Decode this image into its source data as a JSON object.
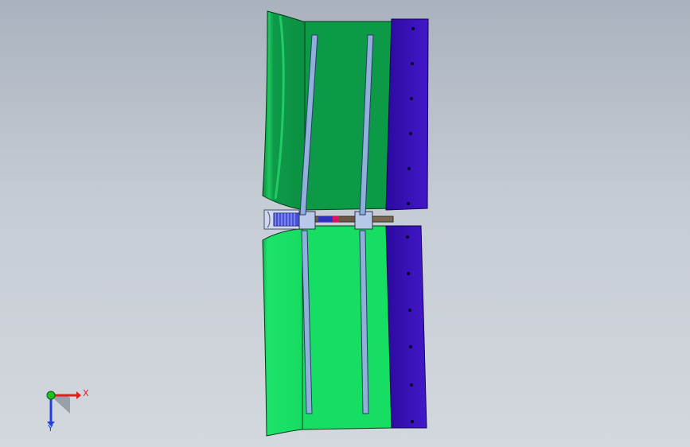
{
  "viewport": {
    "background_top": "#a9b2be",
    "background_bottom": "#d3d8de"
  },
  "model": {
    "upper_panel_color": "#0a9a48",
    "lower_panel_color": "#14e064",
    "clamp_color": "#3a10b8",
    "rail_color": "#8fb0d8",
    "hinge_color": "#7a6a55"
  },
  "triad": {
    "x_label": "X",
    "y_label": "Y",
    "x_color": "#e02020",
    "y_color": "#20c020",
    "z_color": "#2040e0"
  }
}
